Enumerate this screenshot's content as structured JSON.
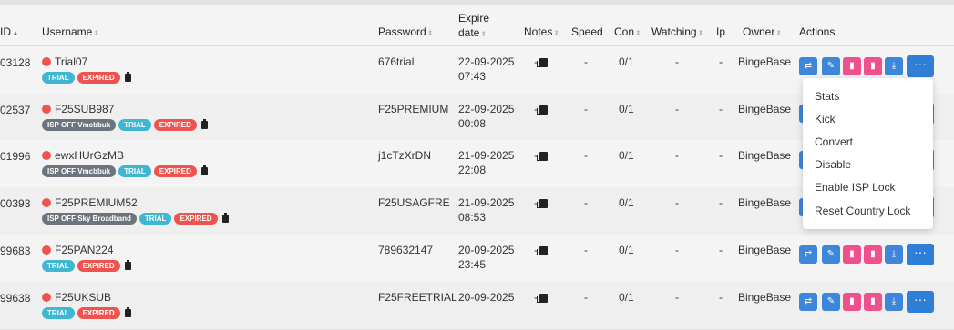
{
  "headers": {
    "id": "ID",
    "username": "Username",
    "password": "Password",
    "expire_line1": "Expire",
    "expire_line2": "date",
    "notes": "Notes",
    "speed": "Speed",
    "con": "Con",
    "watching": "Watching",
    "ip": "Ip",
    "owner": "Owner",
    "actions": "Actions"
  },
  "badge_labels": {
    "trial": "TRIAL",
    "expired": "EXPIRED"
  },
  "rows": [
    {
      "id": "03128",
      "username": "Trial07",
      "isp": "",
      "password": "676trial",
      "date": "22-09-2025",
      "time": "07:43",
      "notes": "-",
      "speed": "-",
      "con": "0/1",
      "watching": "-",
      "ip": "-",
      "owner": "BingeBase"
    },
    {
      "id": "02537",
      "username": "F25SUB987",
      "isp": "ISP OFF Vmcbbuk",
      "password": "F25PREMIUM",
      "date": "22-09-2025",
      "time": "00:08",
      "notes": "-",
      "speed": "-",
      "con": "0/1",
      "watching": "-",
      "ip": "-",
      "owner": "BingeBase"
    },
    {
      "id": "01996",
      "username": "ewxHUrGzMB",
      "isp": "ISP OFF Vmcbbuk",
      "password": "j1cTzXrDN",
      "date": "21-09-2025",
      "time": "22:08",
      "notes": "-",
      "speed": "-",
      "con": "0/1",
      "watching": "-",
      "ip": "-",
      "owner": "BingeBase"
    },
    {
      "id": "00393",
      "username": "F25PREMIUM52",
      "isp": "ISP OFF Sky Broadband",
      "password": "F25USAGFRE",
      "date": "21-09-2025",
      "time": "08:53",
      "notes": "-",
      "speed": "-",
      "con": "0/1",
      "watching": "-",
      "ip": "-",
      "owner": "BingeBase"
    },
    {
      "id": "99683",
      "username": "F25PAN224",
      "isp": "",
      "password": "789632147",
      "date": "20-09-2025",
      "time": "23:45",
      "notes": "-",
      "speed": "-",
      "con": "0/1",
      "watching": "-",
      "ip": "-",
      "owner": "BingeBase"
    },
    {
      "id": "99638",
      "username": "F25UKSUB",
      "isp": "",
      "password": "F25FREETRIAL",
      "date": "20-09-2025",
      "time": "",
      "notes": "-",
      "speed": "-",
      "con": "0/1",
      "watching": "-",
      "ip": "-",
      "owner": "BingeBase"
    }
  ],
  "dropdown": {
    "items": [
      "Stats",
      "Kick",
      "Convert",
      "Disable",
      "Enable ISP Lock",
      "Reset Country Lock"
    ]
  },
  "icons": {
    "assign": "user-swap-icon",
    "edit": "pencil-icon",
    "copy1": "clipboard-icon",
    "copy2": "clipboard-icon",
    "download": "download-icon",
    "more": "ellipsis-icon"
  },
  "colors": {
    "blue": "#3d86d9",
    "pink": "#f0508c",
    "status_red": "#ef5350",
    "trial": "#3fb6d2",
    "isp": "#6c757d"
  }
}
